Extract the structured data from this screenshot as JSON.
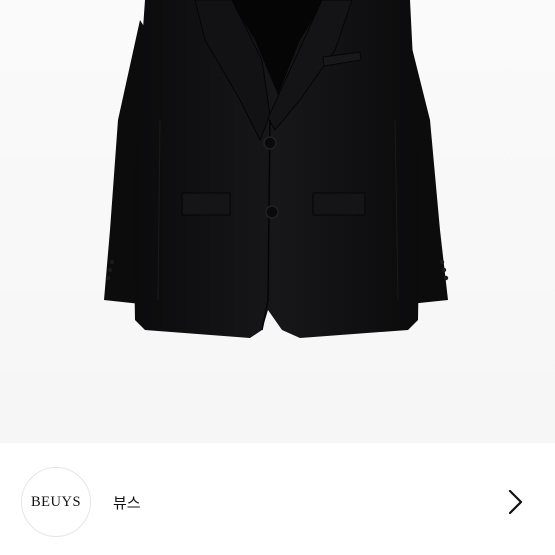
{
  "brand": {
    "logo_text": "BEUYS",
    "name": "뷰스"
  },
  "product_image": {
    "subject": "black-blazer-icon",
    "background_color": "#f7f7f7"
  },
  "colors": {
    "garment": "#0f0f10",
    "garment_shadow": "#050506",
    "garment_highlight": "#1d1d20",
    "text": "#111111"
  },
  "icons": {
    "navigation": "chevron-right-icon"
  }
}
